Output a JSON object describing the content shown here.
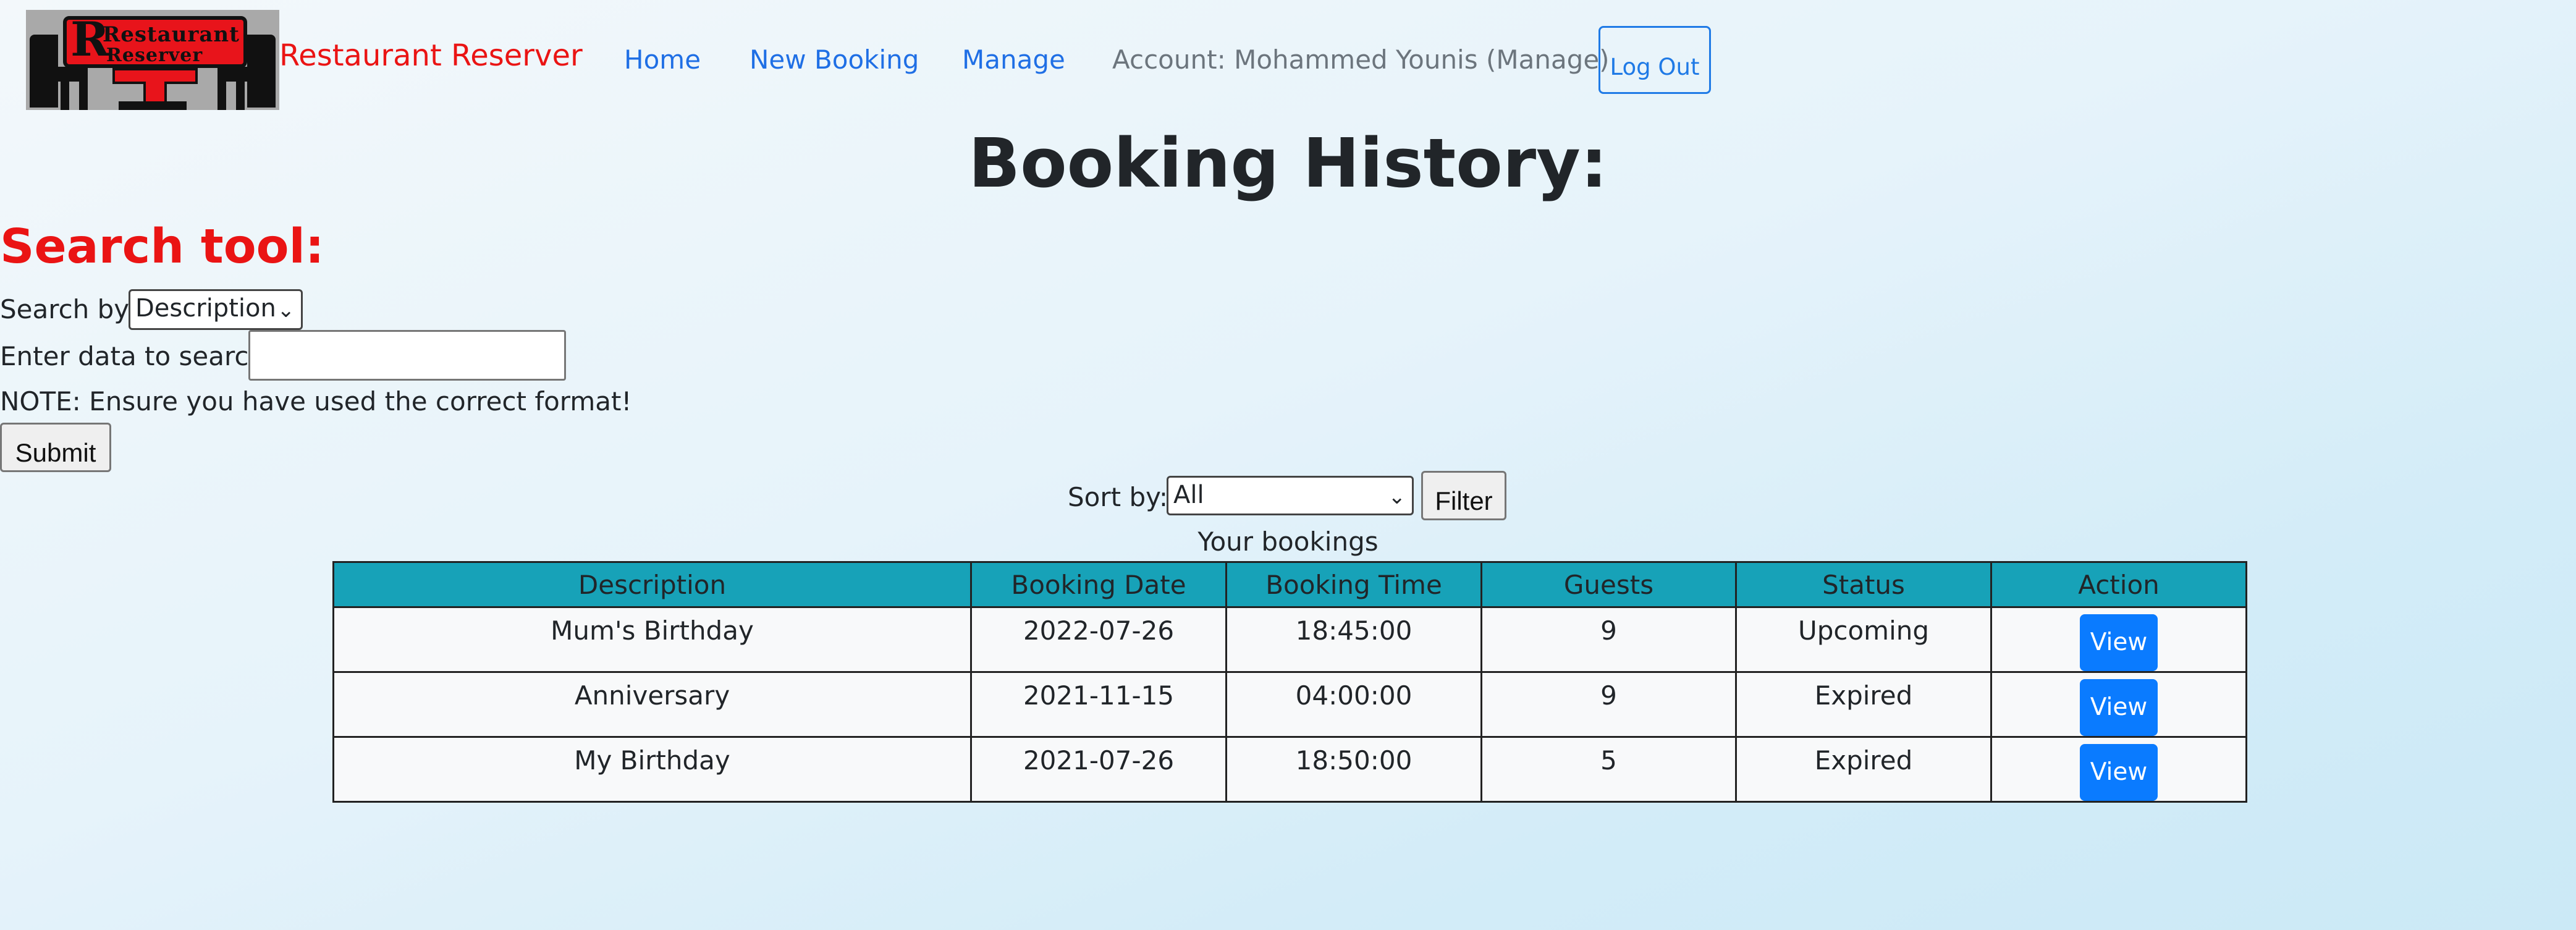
{
  "nav": {
    "logo": {
      "line1": "Restaurant",
      "line2": "Reserver",
      "letter": "R"
    },
    "brand": "Restaurant Reserver",
    "links": [
      "Home",
      "New Booking",
      "Manage"
    ],
    "account": "Account: Mohammed Younis (Manage)",
    "logout": "Log Out",
    "link_color": "#1f6fe5",
    "brand_color": "#ea1414"
  },
  "page": {
    "title": "Booking History:"
  },
  "search": {
    "title": "Search tool:",
    "search_by_label": "Search by:",
    "search_by_value": "Description",
    "enter_label": "Enter data to search:",
    "enter_value": "",
    "note": "NOTE: Ensure you have used the correct format!",
    "submit": "Submit"
  },
  "sort": {
    "label": "Sort by:",
    "value": "All",
    "filter": "Filter"
  },
  "table": {
    "caption": "Your bookings",
    "header_color": "#17a2b8",
    "columns": [
      "Description",
      "Booking Date",
      "Booking Time",
      "Guests",
      "Status",
      "Action"
    ],
    "rows": [
      {
        "description": "Mum's Birthday",
        "date": "2022-07-26",
        "time": "18:45:00",
        "guests": "9",
        "status": "Upcoming",
        "action": "View"
      },
      {
        "description": "Anniversary",
        "date": "2021-11-15",
        "time": "04:00:00",
        "guests": "9",
        "status": "Expired",
        "action": "View"
      },
      {
        "description": "My Birthday",
        "date": "2021-07-26",
        "time": "18:50:00",
        "guests": "5",
        "status": "Expired",
        "action": "View"
      }
    ]
  }
}
